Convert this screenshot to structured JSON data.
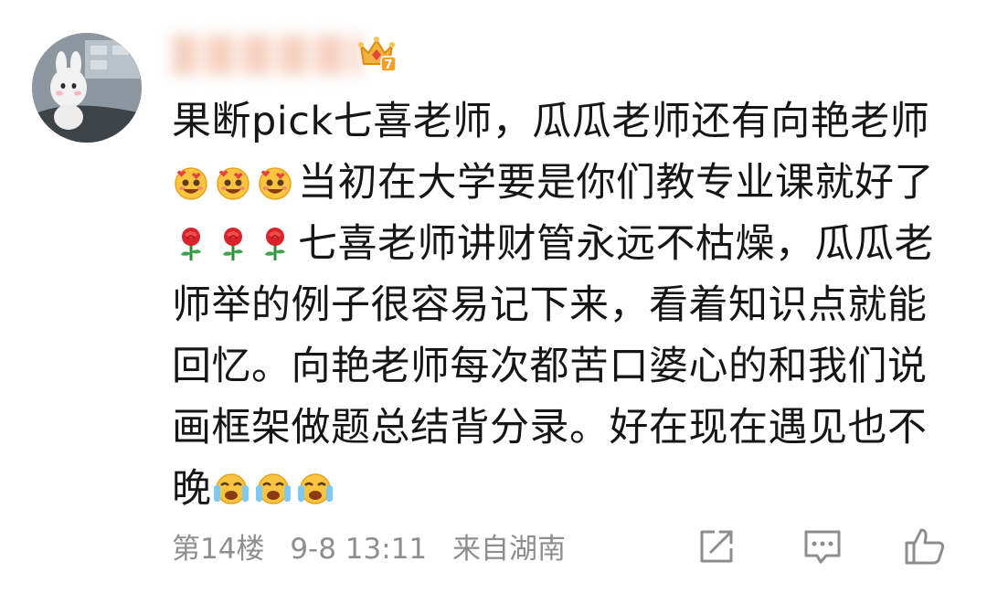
{
  "comment": {
    "lines": [
      {
        "emojis": [],
        "text": "果断pick七喜老师，瓜瓜老师还有向艳老师"
      },
      {
        "emojis": [
          "heart-eyes-icon",
          "heart-eyes-icon",
          "heart-eyes-icon"
        ],
        "text": "当初在大学要是你们教专业课就好了"
      },
      {
        "emojis": [
          "rose-icon",
          "rose-icon",
          "rose-icon"
        ],
        "text": "七喜老师讲财管永远不枯燥，瓜瓜老"
      },
      {
        "emojis": [],
        "text": "师举的例子很容易记下来，看着知识点就能"
      },
      {
        "emojis": [],
        "text": "回忆。向艳老师每次都苦口婆心的和我们说"
      },
      {
        "emojis": [],
        "text": "画框架做题总结背分录。好在现在遇见也不"
      },
      {
        "emojis": [],
        "text": "晚",
        "trailing_emojis": [
          "crying-icon",
          "crying-icon",
          "crying-icon"
        ]
      }
    ]
  },
  "footer": {
    "floor": "第14楼",
    "time": "9-8 13:11",
    "location": "来自湖南"
  },
  "badge": {
    "icon": "crown-level-icon",
    "level": "7"
  },
  "actions": {
    "share_icon": "share-icon",
    "reply_icon": "comment-icon",
    "like_icon": "thumbs-up-icon"
  },
  "colors": {
    "text": "#161616",
    "meta": "#8e8e8e",
    "badge_gold": "#f2b33a"
  }
}
